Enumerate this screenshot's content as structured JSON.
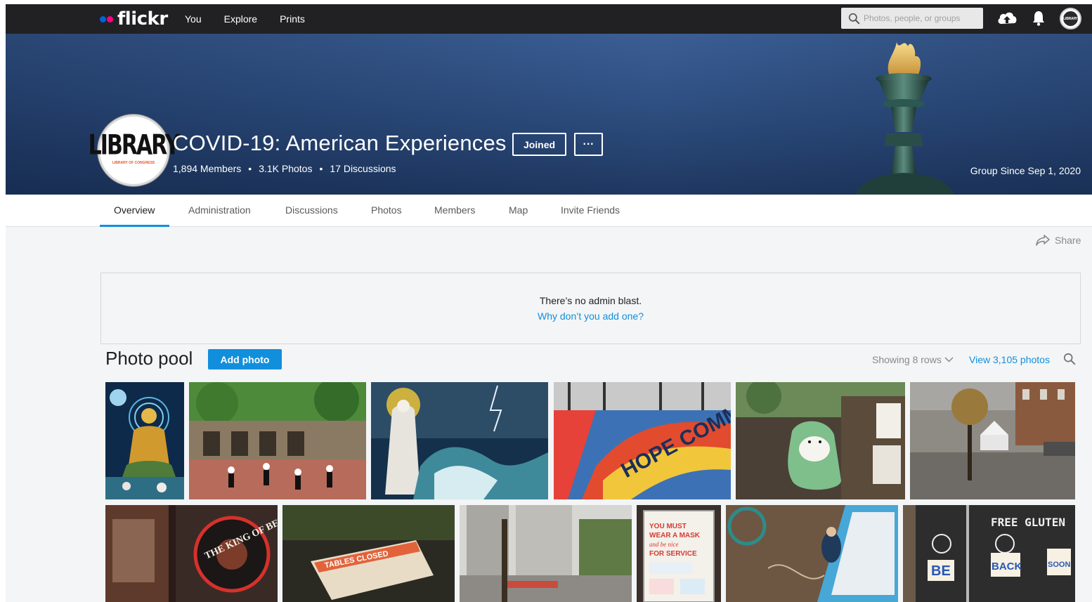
{
  "nav": {
    "logo_text": "flickr",
    "links": [
      "You",
      "Explore",
      "Prints"
    ],
    "search_placeholder": "Photos, people, or groups",
    "avatar_text": "LIBRARY"
  },
  "group": {
    "avatar_text": "LIBRARY",
    "avatar_subtext": "LIBRARY OF CONGRESS",
    "title": "COVID-19: American Experiences",
    "joined_label": "Joined",
    "more_label": "···",
    "members": "1,894 Members",
    "photos": "3.1K Photos",
    "discussions": "17 Discussions",
    "separator": "•",
    "since": "Group Since Sep 1, 2020"
  },
  "tabs": [
    "Overview",
    "Administration",
    "Discussions",
    "Photos",
    "Members",
    "Map",
    "Invite Friends"
  ],
  "share_label": "Share",
  "admin_blast": {
    "message": "There’s no admin blast.",
    "link": "Why don’t you add one?"
  },
  "pool": {
    "title": "Photo pool",
    "add_label": "Add photo",
    "showing": "Showing 8 rows",
    "view_all": "View 3,105 photos"
  },
  "photo_labels": {
    "p3_text": "HOPE COMMUNITY",
    "p7_text": "THE KING OF BEERS SERVED HERE",
    "p8_text": "TABLES CLOSED",
    "p10_line1": "YOU MUST",
    "p10_line2": "WEAR A MASK",
    "p10_line3": "and be nice",
    "p10_line4": "FOR SERVICE",
    "p12_top": "FREE GLUTEN",
    "p12_a": "BE",
    "p12_b": "BACK",
    "p12_c": "SOON"
  },
  "colors": {
    "nav_bg": "#212124",
    "accent_blue": "#128fdc",
    "flickr_blue": "#0063dc",
    "flickr_pink": "#ff0084",
    "page_bg": "#f3f5f6"
  }
}
